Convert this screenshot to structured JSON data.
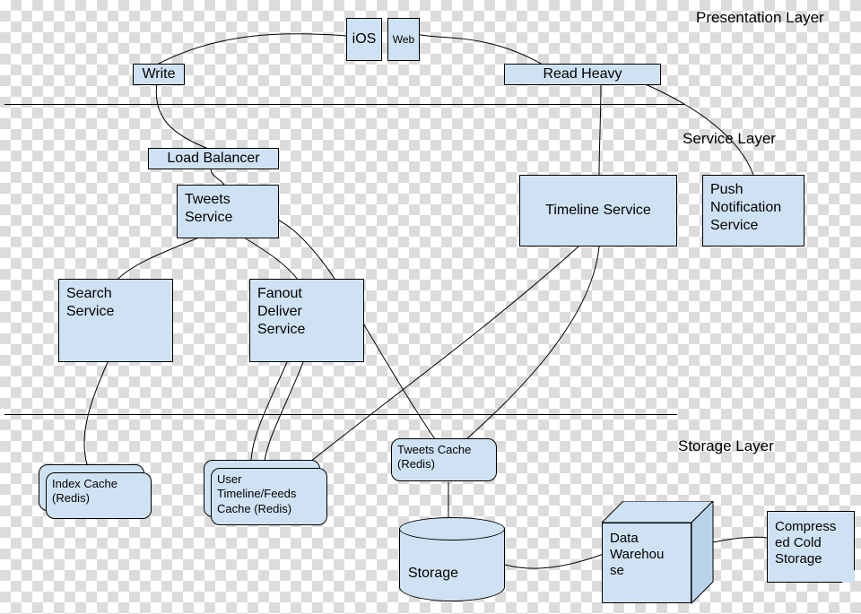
{
  "layers": {
    "presentation": "Presentation Layer",
    "service": "Service Layer",
    "storage": "Storage Layer"
  },
  "nodes": {
    "ios": "iOS",
    "web": "Web",
    "write": "Write",
    "read_heavy": "Read Heavy",
    "load_balancer": "Load Balancer",
    "tweets_service": "Tweets\nService",
    "timeline_service": "Timeline Service",
    "push_notification_service": "Push\nNotification\nService",
    "search_service": "Search\nService",
    "fanout_deliver_service": "Fanout\nDeliver\nService",
    "tweets_cache": "Tweets Cache\n(Redis)",
    "index_cache": "Index Cache\n(Redis)",
    "user_timeline_cache": "User\nTimeline/Feeds\nCache (Redis)",
    "storage": "Storage",
    "data_warehouse": "Data\nWarehou\nse",
    "compressed_cold_storage": "Compress\ned Cold\nStorage"
  }
}
